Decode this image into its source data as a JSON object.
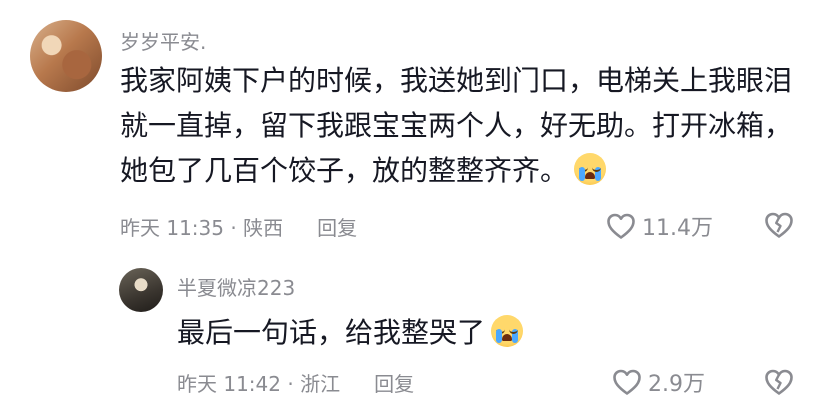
{
  "comments": [
    {
      "username": "岁岁平安.",
      "text": "我家阿姨下户的时候，我送她到门口，电梯关上我眼泪就一直掉，留下我跟宝宝两个人，好无助。打开冰箱，她包了几百个饺子，放的整整齐齐。",
      "emoji": "loudly-crying-face-emoji",
      "time_location": "昨天 11:35 · 陕西",
      "reply_label": "回复",
      "likes": "11.4万"
    },
    {
      "username": "半夏微凉223",
      "text": "最后一句话，给我整哭了",
      "emoji": "loudly-crying-face-emoji",
      "time_location": "昨天 11:42 · 浙江",
      "reply_label": "回复",
      "likes": "2.9万"
    }
  ]
}
